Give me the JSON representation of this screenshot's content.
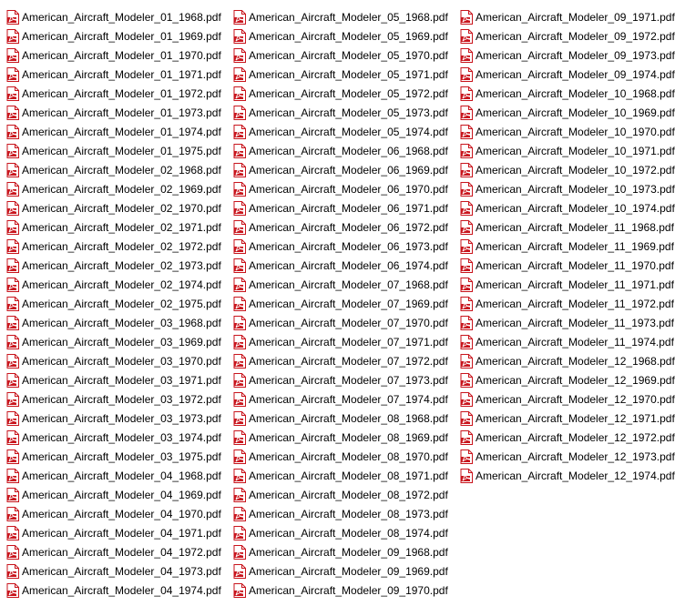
{
  "file_icon": "pdf-file-icon",
  "accent_color": "#c8141c",
  "files": [
    "American_Aircraft_Modeler_01_1968.pdf",
    "American_Aircraft_Modeler_01_1969.pdf",
    "American_Aircraft_Modeler_01_1970.pdf",
    "American_Aircraft_Modeler_01_1971.pdf",
    "American_Aircraft_Modeler_01_1972.pdf",
    "American_Aircraft_Modeler_01_1973.pdf",
    "American_Aircraft_Modeler_01_1974.pdf",
    "American_Aircraft_Modeler_01_1975.pdf",
    "American_Aircraft_Modeler_02_1968.pdf",
    "American_Aircraft_Modeler_02_1969.pdf",
    "American_Aircraft_Modeler_02_1970.pdf",
    "American_Aircraft_Modeler_02_1971.pdf",
    "American_Aircraft_Modeler_02_1972.pdf",
    "American_Aircraft_Modeler_02_1973.pdf",
    "American_Aircraft_Modeler_02_1974.pdf",
    "American_Aircraft_Modeler_02_1975.pdf",
    "American_Aircraft_Modeler_03_1968.pdf",
    "American_Aircraft_Modeler_03_1969.pdf",
    "American_Aircraft_Modeler_03_1970.pdf",
    "American_Aircraft_Modeler_03_1971.pdf",
    "American_Aircraft_Modeler_03_1972.pdf",
    "American_Aircraft_Modeler_03_1973.pdf",
    "American_Aircraft_Modeler_03_1974.pdf",
    "American_Aircraft_Modeler_03_1975.pdf",
    "American_Aircraft_Modeler_04_1968.pdf",
    "American_Aircraft_Modeler_04_1969.pdf",
    "American_Aircraft_Modeler_04_1970.pdf",
    "American_Aircraft_Modeler_04_1971.pdf",
    "American_Aircraft_Modeler_04_1972.pdf",
    "American_Aircraft_Modeler_04_1973.pdf",
    "American_Aircraft_Modeler_04_1974.pdf",
    "American_Aircraft_Modeler_05_1968.pdf",
    "American_Aircraft_Modeler_05_1969.pdf",
    "American_Aircraft_Modeler_05_1970.pdf",
    "American_Aircraft_Modeler_05_1971.pdf",
    "American_Aircraft_Modeler_05_1972.pdf",
    "American_Aircraft_Modeler_05_1973.pdf",
    "American_Aircraft_Modeler_05_1974.pdf",
    "American_Aircraft_Modeler_06_1968.pdf",
    "American_Aircraft_Modeler_06_1969.pdf",
    "American_Aircraft_Modeler_06_1970.pdf",
    "American_Aircraft_Modeler_06_1971.pdf",
    "American_Aircraft_Modeler_06_1972.pdf",
    "American_Aircraft_Modeler_06_1973.pdf",
    "American_Aircraft_Modeler_06_1974.pdf",
    "American_Aircraft_Modeler_07_1968.pdf",
    "American_Aircraft_Modeler_07_1969.pdf",
    "American_Aircraft_Modeler_07_1970.pdf",
    "American_Aircraft_Modeler_07_1971.pdf",
    "American_Aircraft_Modeler_07_1972.pdf",
    "American_Aircraft_Modeler_07_1973.pdf",
    "American_Aircraft_Modeler_07_1974.pdf",
    "American_Aircraft_Modeler_08_1968.pdf",
    "American_Aircraft_Modeler_08_1969.pdf",
    "American_Aircraft_Modeler_08_1970.pdf",
    "American_Aircraft_Modeler_08_1971.pdf",
    "American_Aircraft_Modeler_08_1972.pdf",
    "American_Aircraft_Modeler_08_1973.pdf",
    "American_Aircraft_Modeler_08_1974.pdf",
    "American_Aircraft_Modeler_09_1968.pdf",
    "American_Aircraft_Modeler_09_1969.pdf",
    "American_Aircraft_Modeler_09_1970.pdf",
    "American_Aircraft_Modeler_09_1971.pdf",
    "American_Aircraft_Modeler_09_1972.pdf",
    "American_Aircraft_Modeler_09_1973.pdf",
    "American_Aircraft_Modeler_09_1974.pdf",
    "American_Aircraft_Modeler_10_1968.pdf",
    "American_Aircraft_Modeler_10_1969.pdf",
    "American_Aircraft_Modeler_10_1970.pdf",
    "American_Aircraft_Modeler_10_1971.pdf",
    "American_Aircraft_Modeler_10_1972.pdf",
    "American_Aircraft_Modeler_10_1973.pdf",
    "American_Aircraft_Modeler_10_1974.pdf",
    "American_Aircraft_Modeler_11_1968.pdf",
    "American_Aircraft_Modeler_11_1969.pdf",
    "American_Aircraft_Modeler_11_1970.pdf",
    "American_Aircraft_Modeler_11_1971.pdf",
    "American_Aircraft_Modeler_11_1972.pdf",
    "American_Aircraft_Modeler_11_1973.pdf",
    "American_Aircraft_Modeler_11_1974.pdf",
    "American_Aircraft_Modeler_12_1968.pdf",
    "American_Aircraft_Modeler_12_1969.pdf",
    "American_Aircraft_Modeler_12_1970.pdf",
    "American_Aircraft_Modeler_12_1971.pdf",
    "American_Aircraft_Modeler_12_1972.pdf",
    "American_Aircraft_Modeler_12_1973.pdf",
    "American_Aircraft_Modeler_12_1974.pdf"
  ]
}
